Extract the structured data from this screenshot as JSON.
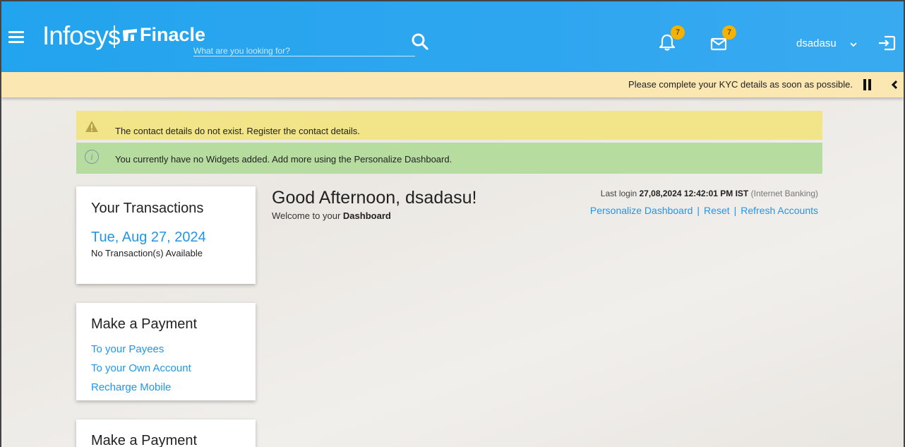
{
  "header": {
    "brand_infosys": "Infosys",
    "brand_finacle": "Finacle",
    "search_placeholder": "What are you looking for?",
    "notifications_count": "7",
    "messages_count": "7",
    "username": "dsadasu"
  },
  "kyc_bar": {
    "message": "Please complete your KYC details as soon as possible."
  },
  "alerts": {
    "warning": "The contact details do not exist. Register the contact details.",
    "info": "You currently have no Widgets added. Add more using the Personalize Dashboard."
  },
  "transactions_card": {
    "title": "Your Transactions",
    "date": "Tue, Aug 27, 2024",
    "empty_text": "No Transaction(s) Available"
  },
  "payment_card": {
    "title": "Make a Payment",
    "links": [
      "To your Payees",
      "To your Own Account",
      "Recharge Mobile"
    ]
  },
  "payment_card_2": {
    "title": "Make a Payment"
  },
  "greeting": {
    "title": "Good Afternoon, dsadasu!",
    "welcome_prefix": "Welcome to your ",
    "welcome_bold": "Dashboard"
  },
  "last_login": {
    "label": "Last login ",
    "datetime": "27,08,2024 12:42:01 PM IST",
    "channel": "(Internet Banking)"
  },
  "dashboard_links": {
    "personalize": "Personalize Dashboard",
    "reset": "Reset",
    "refresh": "Refresh Accounts",
    "separator": "|"
  },
  "colors": {
    "header_blue": "#2ea6ef",
    "kyc_bar": "#fbe7b1",
    "warning_bg": "#f2e488",
    "info_bg": "#b7dca0",
    "link_blue": "#2196e8",
    "badge": "#f5b300"
  }
}
